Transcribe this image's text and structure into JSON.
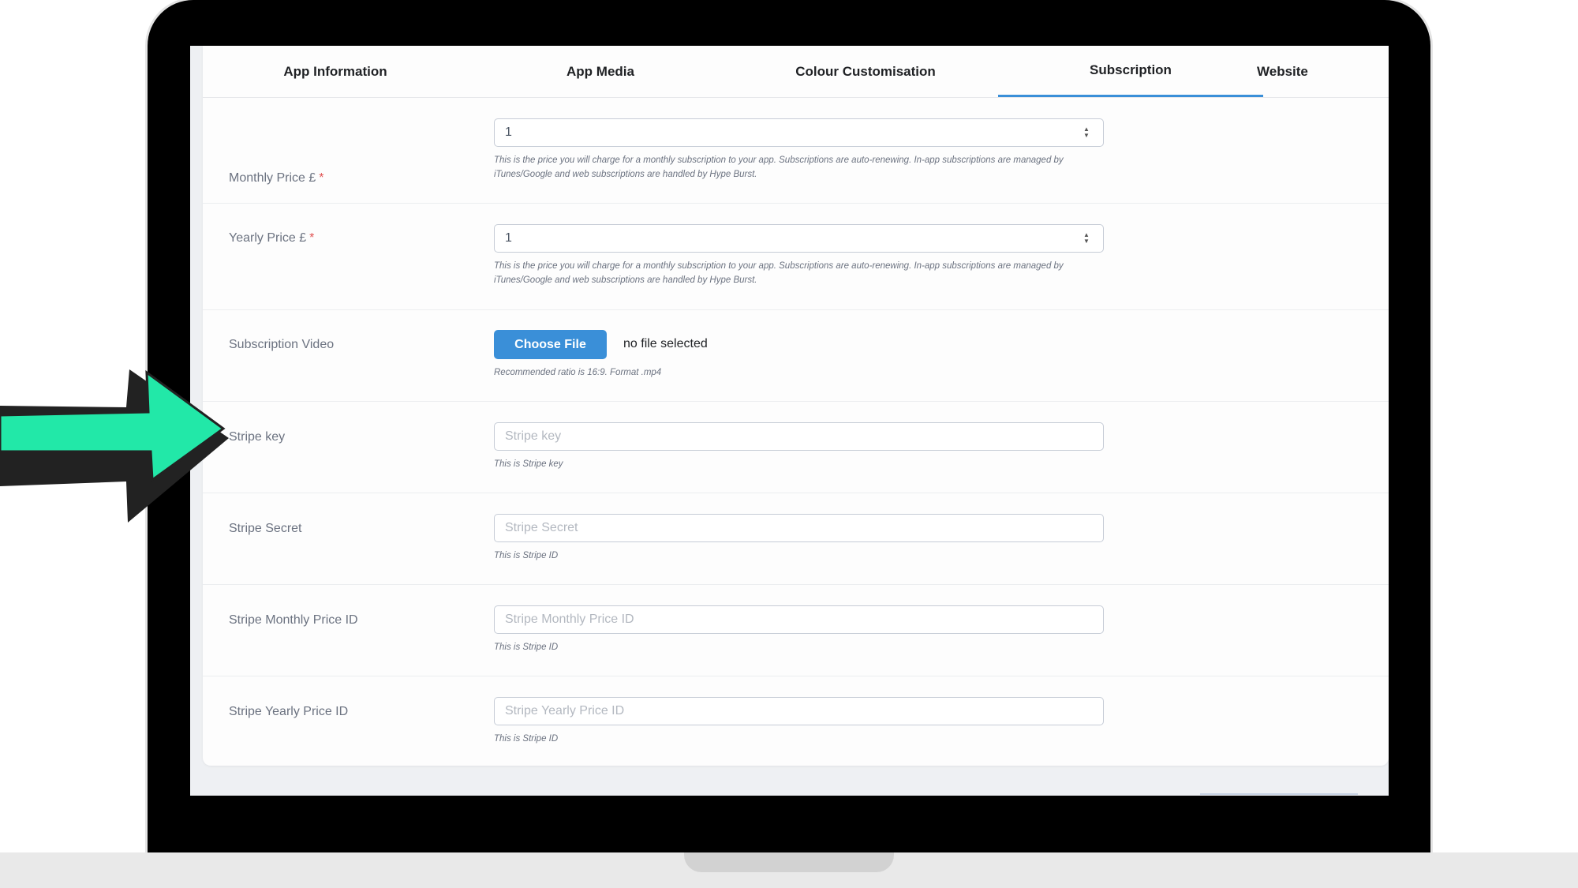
{
  "tabs": [
    {
      "label": "App Information",
      "active": false
    },
    {
      "label": "App Media",
      "active": false
    },
    {
      "label": "Colour Customisation",
      "active": false
    },
    {
      "label": "Subscription",
      "active": true
    },
    {
      "label": "Website",
      "active": false
    }
  ],
  "form": {
    "monthly_price": {
      "label": "Monthly Price £",
      "required_mark": "*",
      "value": "1",
      "help": "This is the price you will charge for a monthly subscription to your app. Subscriptions are auto-renewing. In-app subscriptions are managed by iTunes/Google and web subscriptions are handled by Hype Burst."
    },
    "yearly_price": {
      "label": "Yearly Price £",
      "required_mark": "*",
      "value": "1",
      "help": "This is the price you will charge for a monthly subscription to your app. Subscriptions are auto-renewing. In-app subscriptions are managed by iTunes/Google and web subscriptions are handled by Hype Burst."
    },
    "subscription_video": {
      "label": "Subscription Video",
      "button": "Choose File",
      "status": "no file selected",
      "help": "Recommended ratio is 16:9. Format .mp4"
    },
    "stripe_key": {
      "label": "Stripe key",
      "placeholder": "Stripe key",
      "help": "This is Stripe key"
    },
    "stripe_secret": {
      "label": "Stripe Secret",
      "placeholder": "Stripe Secret",
      "help": "This is Stripe ID"
    },
    "stripe_monthly_price_id": {
      "label": "Stripe Monthly Price ID",
      "placeholder": "Stripe Monthly Price ID",
      "help": "This is Stripe ID"
    },
    "stripe_yearly_price_id": {
      "label": "Stripe Yearly Price ID",
      "placeholder": "Stripe Yearly Price ID",
      "help": "This is Stripe ID"
    }
  },
  "colors": {
    "accent": "#3a8fd8",
    "arrow_fill": "#22e8a8",
    "arrow_outline": "#222222",
    "required": "#e05252"
  }
}
